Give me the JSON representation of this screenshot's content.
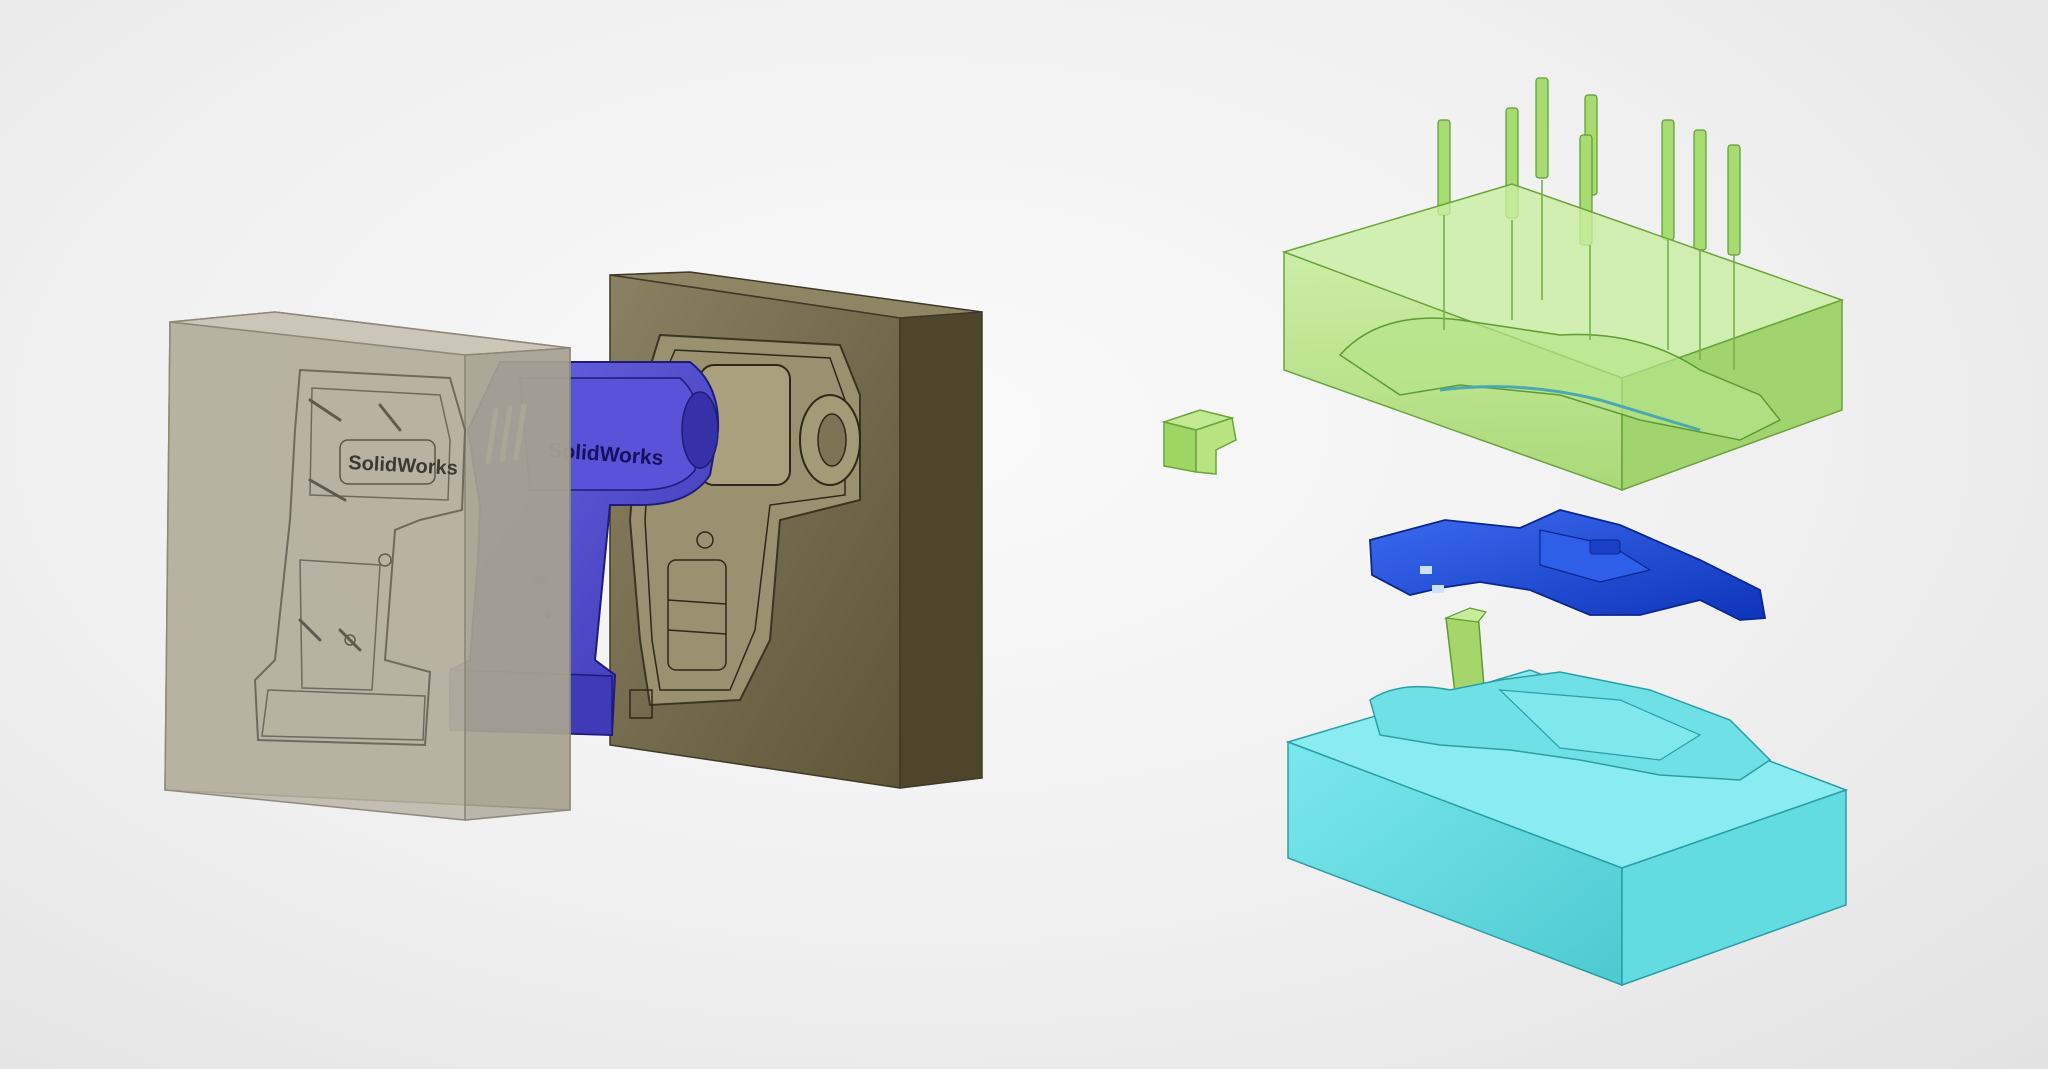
{
  "scene": {
    "brand_text": "SolidWorks",
    "colors": {
      "background": "#efefef",
      "left_mold_half": "#b9b3a3",
      "right_mold_half": "#6e6547",
      "drill_housing": "#4b46c8",
      "core_block": "#9ed563",
      "molded_part": "#1d48d8",
      "cavity_block": "#55d3d9",
      "side_action": "#9ccf55",
      "ejector_pins": "#8fcf5a"
    },
    "icons": {
      "left_assembly": "mold-assembly-icon",
      "right_assembly": "exploded-mold-icon"
    }
  }
}
